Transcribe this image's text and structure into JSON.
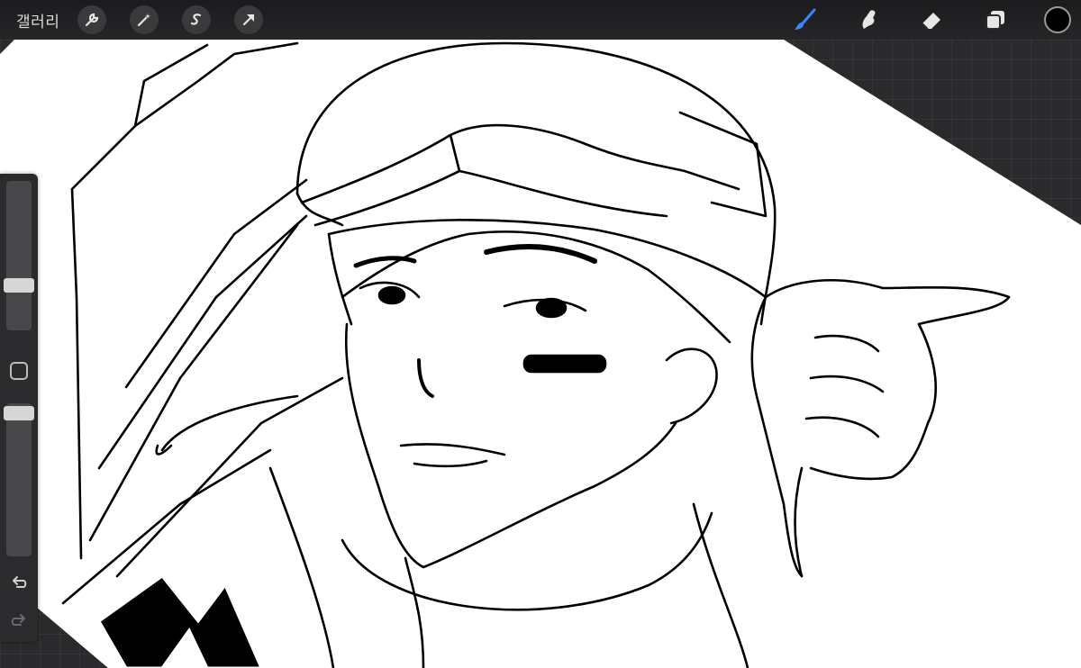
{
  "topbar": {
    "gallery_label": "갤러리",
    "left_tools": [
      "wrench-icon",
      "magic-wand-icon",
      "selection-icon",
      "transform-arrow-icon"
    ],
    "right_tools": [
      "brush-icon",
      "smudge-icon",
      "eraser-icon",
      "layers-icon"
    ],
    "active_tool": "brush-icon",
    "active_color": "#000000",
    "accent_color": "#3a86ff"
  },
  "sidebar": {
    "brush_size_level": 0.62,
    "opacity_level": 0.02,
    "modify_button": "modify-square-icon",
    "undo": "undo-icon",
    "redo": "redo-icon"
  }
}
